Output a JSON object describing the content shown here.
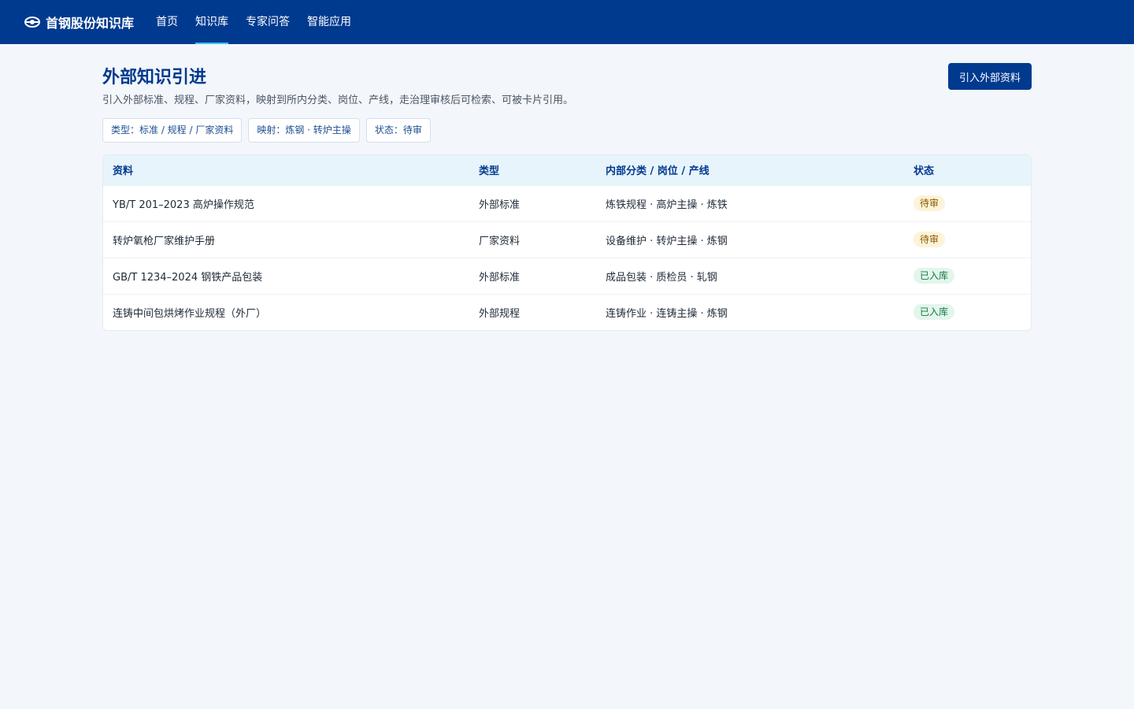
{
  "header": {
    "brand": "首钢股份知识库",
    "nav": [
      {
        "label": "首页",
        "active": false
      },
      {
        "label": "知识库",
        "active": true
      },
      {
        "label": "专家问答",
        "active": false
      },
      {
        "label": "智能应用",
        "active": false
      }
    ],
    "brand_icon": "steel-logo-icon"
  },
  "page": {
    "title": "外部知识引进",
    "description": "引入外部标准、规程、厂家资料，映射到所内分类、岗位、产线，走治理审核后可检索、可被卡片引用。",
    "import_button": "引入外部资料"
  },
  "filters": [
    "类型：标准 / 规程 / 厂家资料",
    "映射：炼钢 · 转炉主操",
    "状态：待审"
  ],
  "table": {
    "columns": [
      "资料",
      "类型",
      "内部分类 / 岗位 / 产线",
      "状态"
    ],
    "rows": [
      {
        "name": "YB/T 201–2023 高炉操作规范",
        "type": "外部标准",
        "mapping": "炼铁规程 · 高炉主操 · 炼铁",
        "status": "待审",
        "status_kind": "pending"
      },
      {
        "name": "转炉氧枪厂家维护手册",
        "type": "厂家资料",
        "mapping": "设备维护 · 转炉主操 · 炼钢",
        "status": "待审",
        "status_kind": "pending"
      },
      {
        "name": "GB/T 1234–2024 钢铁产品包装",
        "type": "外部标准",
        "mapping": "成品包装 · 质检员 · 轧钢",
        "status": "已入库",
        "status_kind": "done"
      },
      {
        "name": "连铸中间包烘烤作业规程（外厂）",
        "type": "外部规程",
        "mapping": "连铸作业 · 连铸主操 · 炼钢",
        "status": "已入库",
        "status_kind": "done"
      }
    ]
  },
  "colors": {
    "primary": "#003a8f",
    "nav_active_underline": "#3ec1ff",
    "pending_bg": "#fdf3d8",
    "done_bg": "#e3f5ec"
  }
}
